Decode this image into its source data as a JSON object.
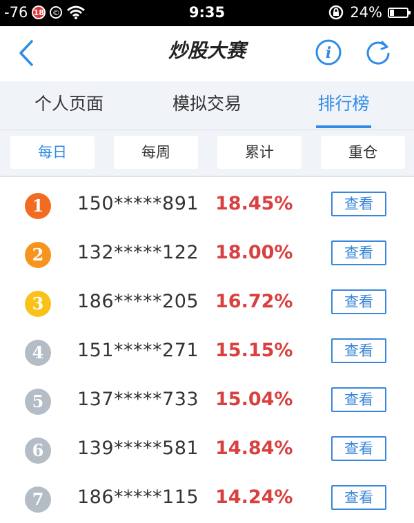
{
  "status_bar": {
    "signal": "-76",
    "badge": "18",
    "copyright": "©",
    "time": "9:35",
    "battery_pct": "24%",
    "battery_level": 0.24
  },
  "nav": {
    "title": "炒股大赛",
    "info_icon_glyph": "i"
  },
  "tabs": [
    {
      "label": "个人页面",
      "active": false
    },
    {
      "label": "模拟交易",
      "active": false
    },
    {
      "label": "排行榜",
      "active": true
    }
  ],
  "subtabs": [
    {
      "label": "每日",
      "active": true
    },
    {
      "label": "每周",
      "active": false
    },
    {
      "label": "累计",
      "active": false
    },
    {
      "label": "重仓",
      "active": false
    }
  ],
  "rank_colors": {
    "1": "#f26b21",
    "2": "#f7941d",
    "3": "#f9c21a",
    "other": "#b4bcc6"
  },
  "accent_color": "#2f8be6",
  "rows": [
    {
      "rank": "1",
      "phone": "150*****891",
      "pct": "18.45%",
      "button": "查看"
    },
    {
      "rank": "2",
      "phone": "132*****122",
      "pct": "18.00%",
      "button": "查看"
    },
    {
      "rank": "3",
      "phone": "186*****205",
      "pct": "16.72%",
      "button": "查看"
    },
    {
      "rank": "4",
      "phone": "151*****271",
      "pct": "15.15%",
      "button": "查看"
    },
    {
      "rank": "5",
      "phone": "137*****733",
      "pct": "15.04%",
      "button": "查看"
    },
    {
      "rank": "6",
      "phone": "139*****581",
      "pct": "14.84%",
      "button": "查看"
    },
    {
      "rank": "7",
      "phone": "186*****115",
      "pct": "14.24%",
      "button": "查看"
    }
  ]
}
